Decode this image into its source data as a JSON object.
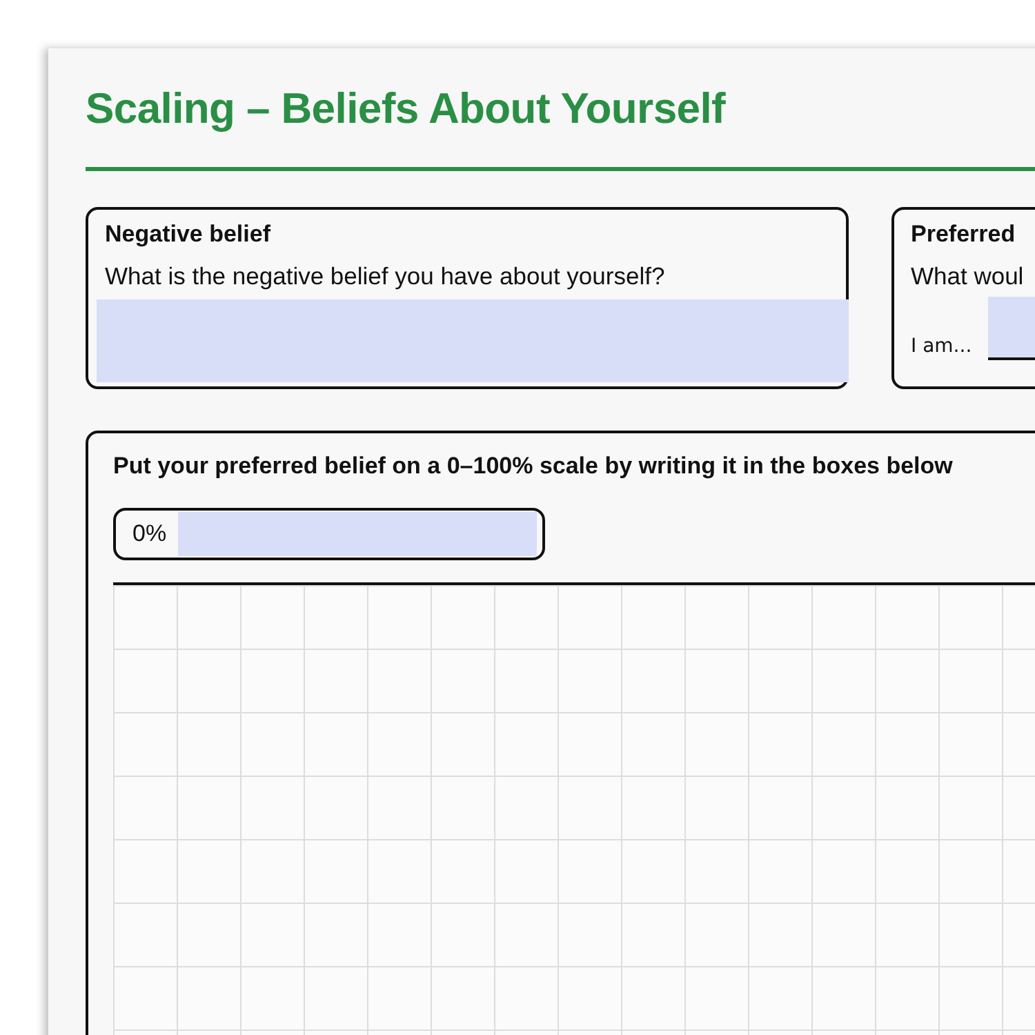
{
  "title": "Scaling – Beliefs About Yourself",
  "negative_belief": {
    "heading": "Negative belief",
    "prompt": "What is the negative belief you have about yourself?"
  },
  "preferred_belief": {
    "heading": "Preferred",
    "prompt": "What woul",
    "answer_label": "I am..."
  },
  "scale": {
    "instruction": "Put your preferred belief on a 0–100% scale by writing it in the boxes below",
    "start_label": "0%"
  }
}
